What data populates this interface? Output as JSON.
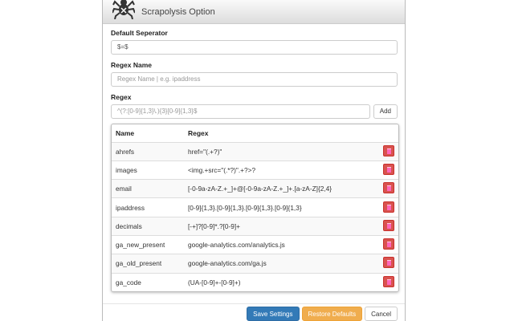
{
  "header": {
    "title": "Scrapolysis Option"
  },
  "form": {
    "separator_label": "Default Seperator",
    "separator_value": "$=$",
    "name_label": "Regex Name",
    "name_placeholder": "Regex Name | e.g. ipaddress",
    "regex_label": "Regex",
    "regex_placeholder": "^(?:[0-9]{1,3}\\.){3}[0-9]{1,3}$",
    "add_label": "Add"
  },
  "table": {
    "headers": [
      "Name",
      "Regex"
    ],
    "rows": [
      {
        "name": "ahrefs",
        "regex": "href=\"(.+?)\""
      },
      {
        "name": "images",
        "regex": "<img.+src=\"(.*?)\".+?>?"
      },
      {
        "name": "email",
        "regex": "[-0-9a-zA-Z.+_]+@[-0-9a-zA-Z.+_]+.[a-zA-Z]{2,4}"
      },
      {
        "name": "ipaddress",
        "regex": "[0-9]{1,3}.[0-9]{1,3}.[0-9]{1,3}.[0-9]{1,3}"
      },
      {
        "name": "decimals",
        "regex": "[-+]?[0-9]*.?[0-9]+"
      },
      {
        "name": "ga_new_present",
        "regex": "google-analytics.com/analytics.js"
      },
      {
        "name": "ga_old_present",
        "regex": "google-analytics.com/ga.js"
      },
      {
        "name": "ga_code",
        "regex": "(UA-[0-9]+-[0-9]+)"
      }
    ]
  },
  "footer": {
    "save": "Save Settings",
    "restore": "Restore Defaults",
    "cancel": "Cancel"
  }
}
